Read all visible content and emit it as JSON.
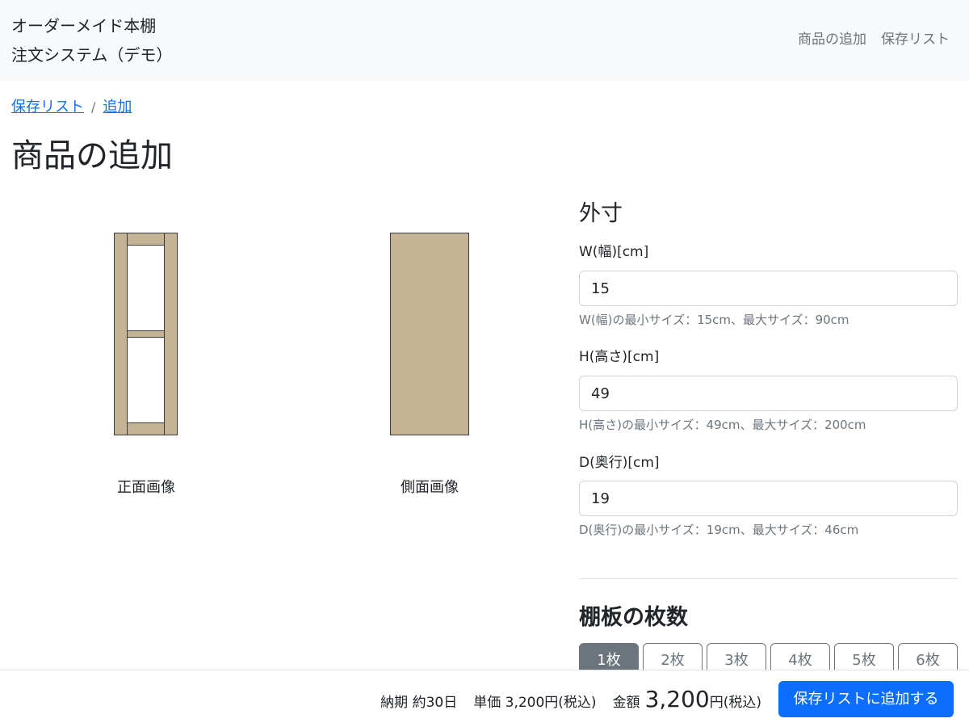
{
  "header": {
    "brand_line1": "オーダーメイド本棚",
    "brand_line2": "注文システム（デモ）",
    "nav": [
      "商品の追加",
      "保存リスト"
    ]
  },
  "breadcrumb": {
    "items": [
      "保存リスト",
      "追加"
    ],
    "separator": "/"
  },
  "page_title": "商品の追加",
  "preview": {
    "front_caption": "正面画像",
    "side_caption": "側面画像",
    "wood_color": "#c4b394",
    "edge_color": "#3a3a3a"
  },
  "dimensions": {
    "section_title": "外寸",
    "fields": [
      {
        "label": "W(幅)[cm]",
        "value": "15",
        "help": "W(幅)の最小サイズ：15cm、最大サイズ：90cm"
      },
      {
        "label": "H(高さ)[cm]",
        "value": "49",
        "help": "H(高さ)の最小サイズ：49cm、最大サイズ：200cm"
      },
      {
        "label": "D(奥行)[cm]",
        "value": "19",
        "help": "D(奥行)の最小サイズ：19cm、最大サイズ：46cm"
      }
    ]
  },
  "shelves": {
    "title": "棚板の枚数",
    "options": [
      "1枚",
      "2枚",
      "3枚",
      "4枚",
      "5枚",
      "6枚"
    ],
    "selected": "1枚"
  },
  "footer": {
    "delivery": "納期 約30日",
    "unit_price": "単価 3,200円(税込)",
    "total_label": "金額",
    "total_value": "3,200",
    "total_suffix": "円(税込)",
    "add_button": "保存リストに追加する"
  },
  "colors": {
    "primary": "#0d6efd",
    "secondary": "#6c757d",
    "navbar_bg": "#f8f9fa"
  }
}
